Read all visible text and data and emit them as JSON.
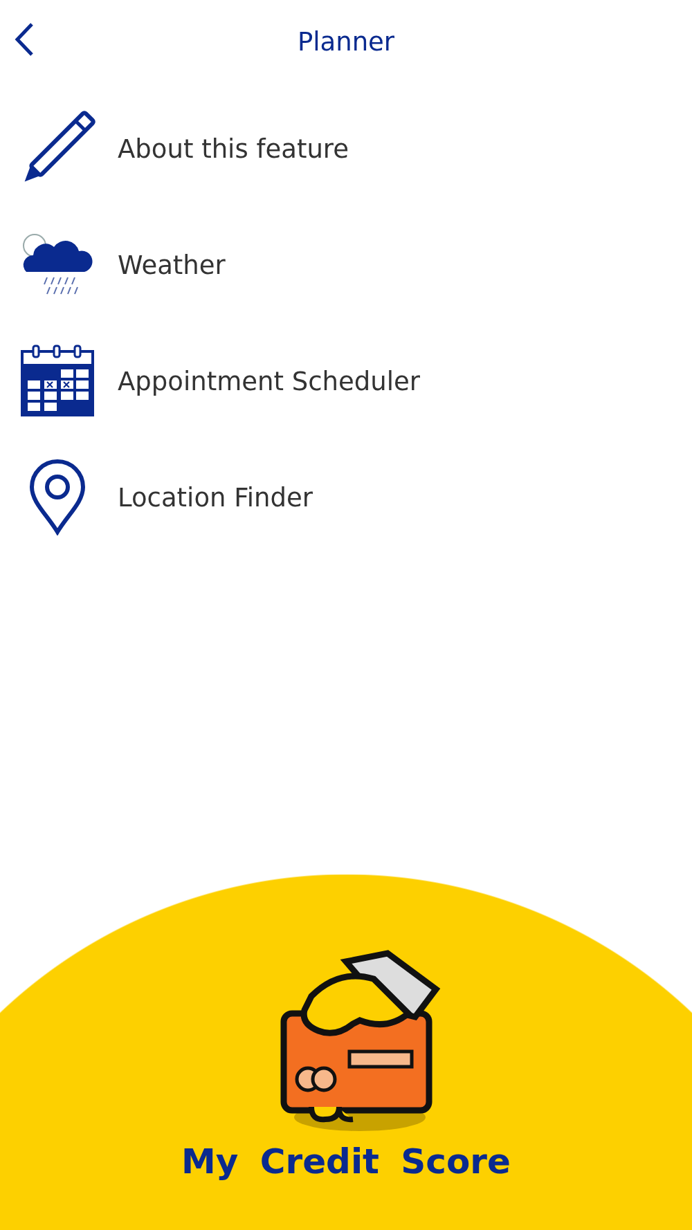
{
  "header": {
    "title": "Planner"
  },
  "menu_items": [
    {
      "label": "About this feature",
      "kind": "pencil"
    },
    {
      "label": "Weather",
      "kind": "weather"
    },
    {
      "label": "Appointment Scheduler",
      "kind": "calendar"
    },
    {
      "label": "Location Finder",
      "kind": "pin"
    }
  ],
  "footer": {
    "label": "My Credit Score"
  }
}
